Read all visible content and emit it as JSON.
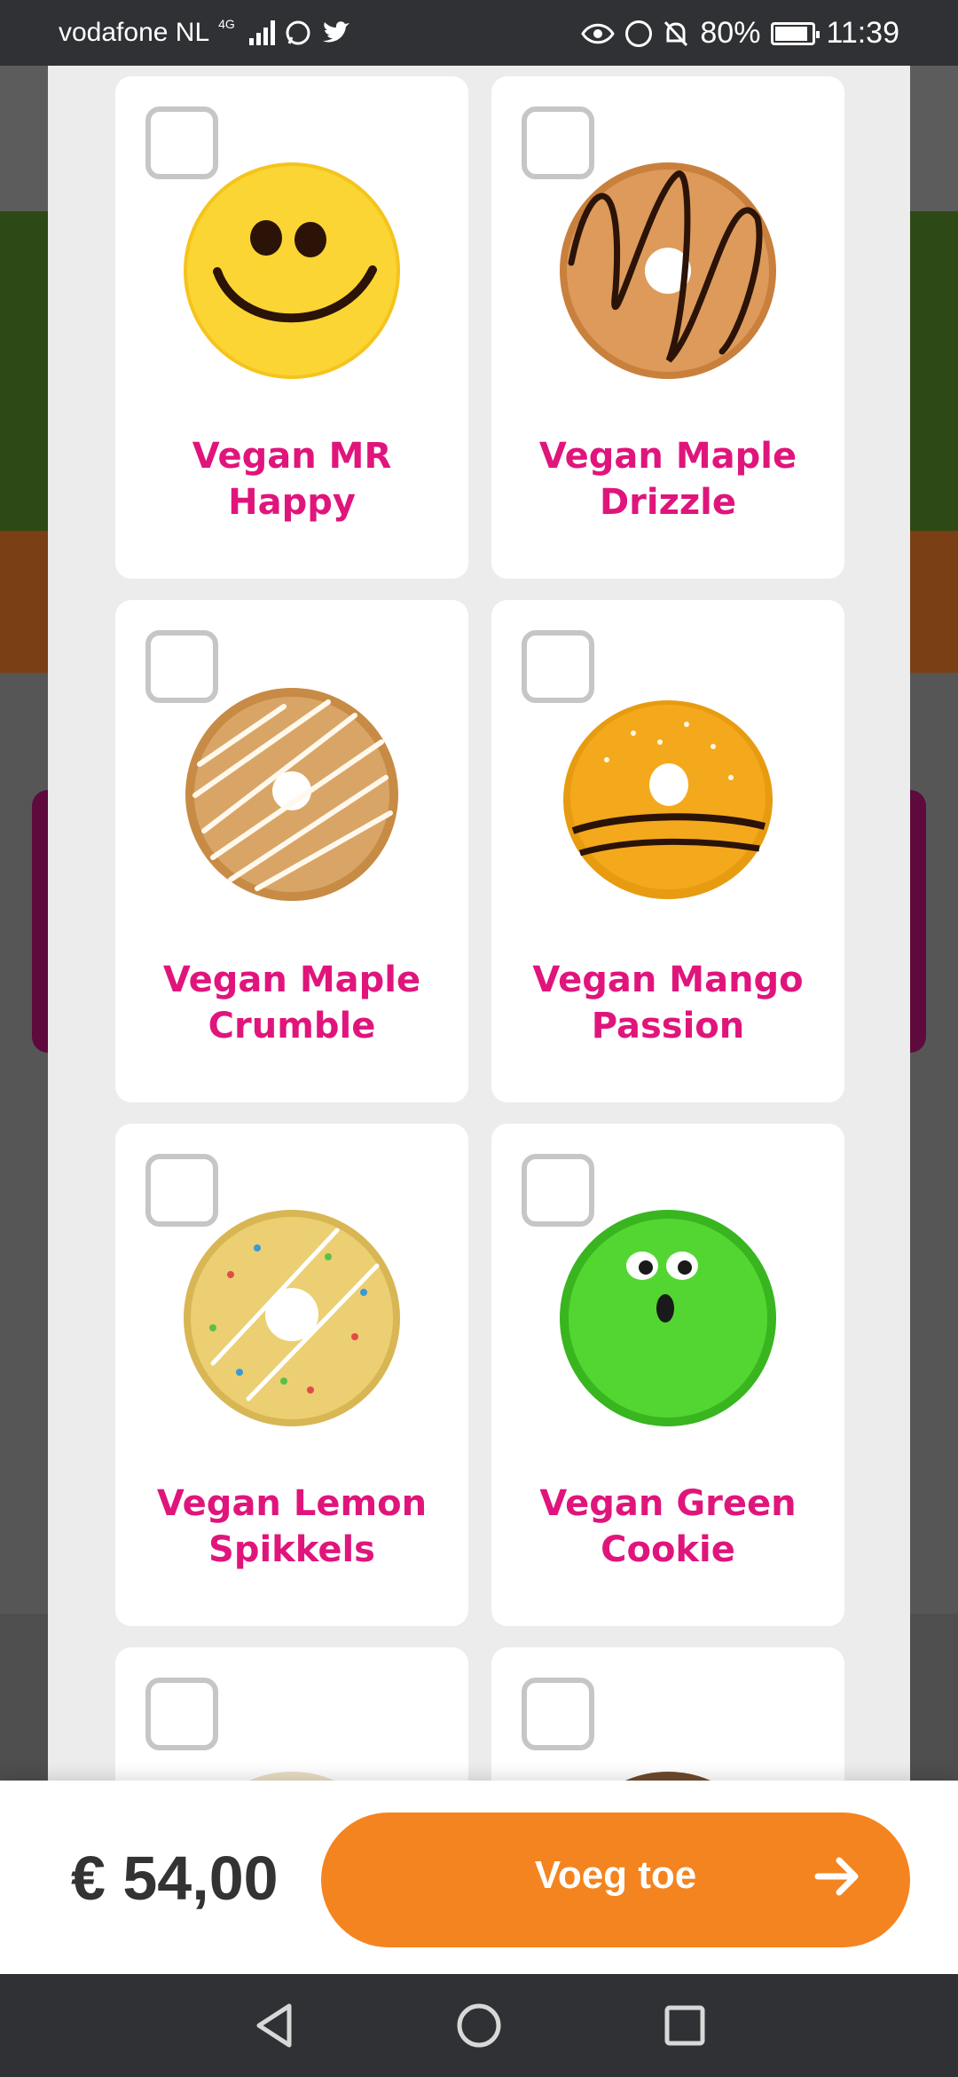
{
  "status_bar": {
    "carrier": "vodafone NL",
    "network": "4G",
    "battery": "80%",
    "time": "11:39"
  },
  "products": [
    {
      "name": "Vegan MR Happy",
      "icon": "smiley-donut-image",
      "checked": false
    },
    {
      "name": "Vegan Maple Drizzle",
      "icon": "maple-drizzle-donut-image",
      "checked": false
    },
    {
      "name": "Vegan Maple Crumble",
      "icon": "maple-crumble-donut-image",
      "checked": false
    },
    {
      "name": "Vegan Mango Passion",
      "icon": "mango-passion-donut-image",
      "checked": false
    },
    {
      "name": "Vegan Lemon Spikkels",
      "icon": "lemon-sprinkles-donut-image",
      "checked": false
    },
    {
      "name": "Vegan Green Cookie",
      "icon": "green-monster-donut-image",
      "checked": false
    }
  ],
  "footer": {
    "price": "€ 54,00",
    "add_button": "Voeg toe"
  },
  "colors": {
    "title": "#e0157c",
    "accent": "#f4841f",
    "modal_bg": "#ececec"
  }
}
